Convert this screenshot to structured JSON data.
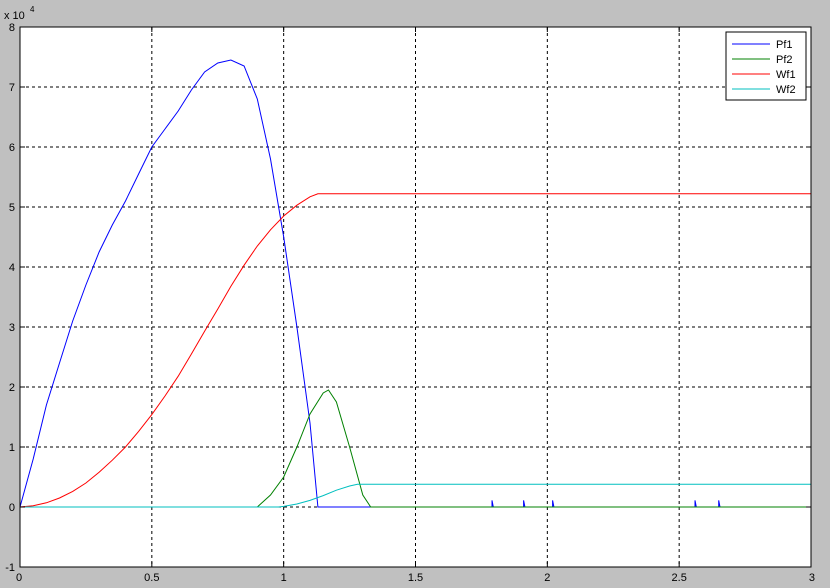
{
  "chart_data": {
    "type": "line",
    "title": "",
    "xlabel": "",
    "ylabel": "",
    "xlim": [
      0,
      3
    ],
    "ylim": [
      -10000,
      80000
    ],
    "y_exponent_label": "x 10",
    "y_exponent_power": "4",
    "x_ticks": [
      0,
      0.5,
      1,
      1.5,
      2,
      2.5,
      3
    ],
    "x_tick_labels": [
      "0",
      "0.5",
      "1",
      "1.5",
      "2",
      "2.5",
      "3"
    ],
    "y_ticks": [
      -10000,
      0,
      10000,
      20000,
      30000,
      40000,
      50000,
      60000,
      70000,
      80000
    ],
    "y_tick_labels": [
      "-1",
      "0",
      "1",
      "2",
      "3",
      "4",
      "5",
      "6",
      "7",
      "8"
    ],
    "grid": true,
    "legend_position": "top-right",
    "background": "#ffffff",
    "series": [
      {
        "name": "Pf1",
        "color": "#0000ff",
        "points": [
          [
            0,
            0
          ],
          [
            0.05,
            8000
          ],
          [
            0.1,
            17000
          ],
          [
            0.15,
            24000
          ],
          [
            0.2,
            31000
          ],
          [
            0.25,
            37000
          ],
          [
            0.3,
            42500
          ],
          [
            0.35,
            47000
          ],
          [
            0.4,
            51000
          ],
          [
            0.45,
            55500
          ],
          [
            0.5,
            60000
          ],
          [
            0.55,
            63000
          ],
          [
            0.6,
            66000
          ],
          [
            0.65,
            69500
          ],
          [
            0.7,
            72500
          ],
          [
            0.75,
            74000
          ],
          [
            0.8,
            74500
          ],
          [
            0.85,
            73500
          ],
          [
            0.9,
            68000
          ],
          [
            0.95,
            58000
          ],
          [
            1.0,
            45000
          ],
          [
            1.05,
            30000
          ],
          [
            1.1,
            14000
          ],
          [
            1.13,
            0
          ],
          [
            1.3,
            0
          ],
          [
            1.79,
            0
          ],
          [
            1.79,
            1100
          ],
          [
            1.795,
            0
          ],
          [
            1.91,
            0
          ],
          [
            1.91,
            1100
          ],
          [
            1.915,
            0
          ],
          [
            2.02,
            0
          ],
          [
            2.02,
            1100
          ],
          [
            2.025,
            0
          ],
          [
            2.56,
            0
          ],
          [
            2.56,
            1100
          ],
          [
            2.565,
            0
          ],
          [
            2.65,
            0
          ],
          [
            2.65,
            1100
          ],
          [
            2.655,
            0
          ],
          [
            3,
            0
          ]
        ]
      },
      {
        "name": "Pf2",
        "color": "#008000",
        "points": [
          [
            0,
            0
          ],
          [
            0.9,
            0
          ],
          [
            0.95,
            2000
          ],
          [
            1.0,
            5000
          ],
          [
            1.05,
            10000
          ],
          [
            1.1,
            15500
          ],
          [
            1.15,
            19000
          ],
          [
            1.17,
            19500
          ],
          [
            1.2,
            17500
          ],
          [
            1.25,
            10000
          ],
          [
            1.3,
            2000
          ],
          [
            1.33,
            0
          ],
          [
            3,
            0
          ]
        ]
      },
      {
        "name": "Wf1",
        "color": "#ff0000",
        "points": [
          [
            0,
            0
          ],
          [
            0.05,
            200
          ],
          [
            0.1,
            700
          ],
          [
            0.15,
            1500
          ],
          [
            0.2,
            2600
          ],
          [
            0.25,
            4000
          ],
          [
            0.3,
            5800
          ],
          [
            0.35,
            7800
          ],
          [
            0.4,
            10000
          ],
          [
            0.45,
            12600
          ],
          [
            0.5,
            15400
          ],
          [
            0.55,
            18500
          ],
          [
            0.6,
            21800
          ],
          [
            0.65,
            25500
          ],
          [
            0.7,
            29300
          ],
          [
            0.75,
            33000
          ],
          [
            0.8,
            36800
          ],
          [
            0.85,
            40300
          ],
          [
            0.9,
            43500
          ],
          [
            0.95,
            46200
          ],
          [
            1.0,
            48500
          ],
          [
            1.05,
            50300
          ],
          [
            1.1,
            51700
          ],
          [
            1.13,
            52200
          ],
          [
            3,
            52200
          ]
        ]
      },
      {
        "name": "Wf2",
        "color": "#00bfbf",
        "points": [
          [
            0,
            0
          ],
          [
            0.98,
            0
          ],
          [
            1.0,
            100
          ],
          [
            1.05,
            500
          ],
          [
            1.1,
            1100
          ],
          [
            1.15,
            1900
          ],
          [
            1.2,
            2800
          ],
          [
            1.25,
            3500
          ],
          [
            1.28,
            3800
          ],
          [
            3,
            3800
          ]
        ]
      }
    ]
  }
}
